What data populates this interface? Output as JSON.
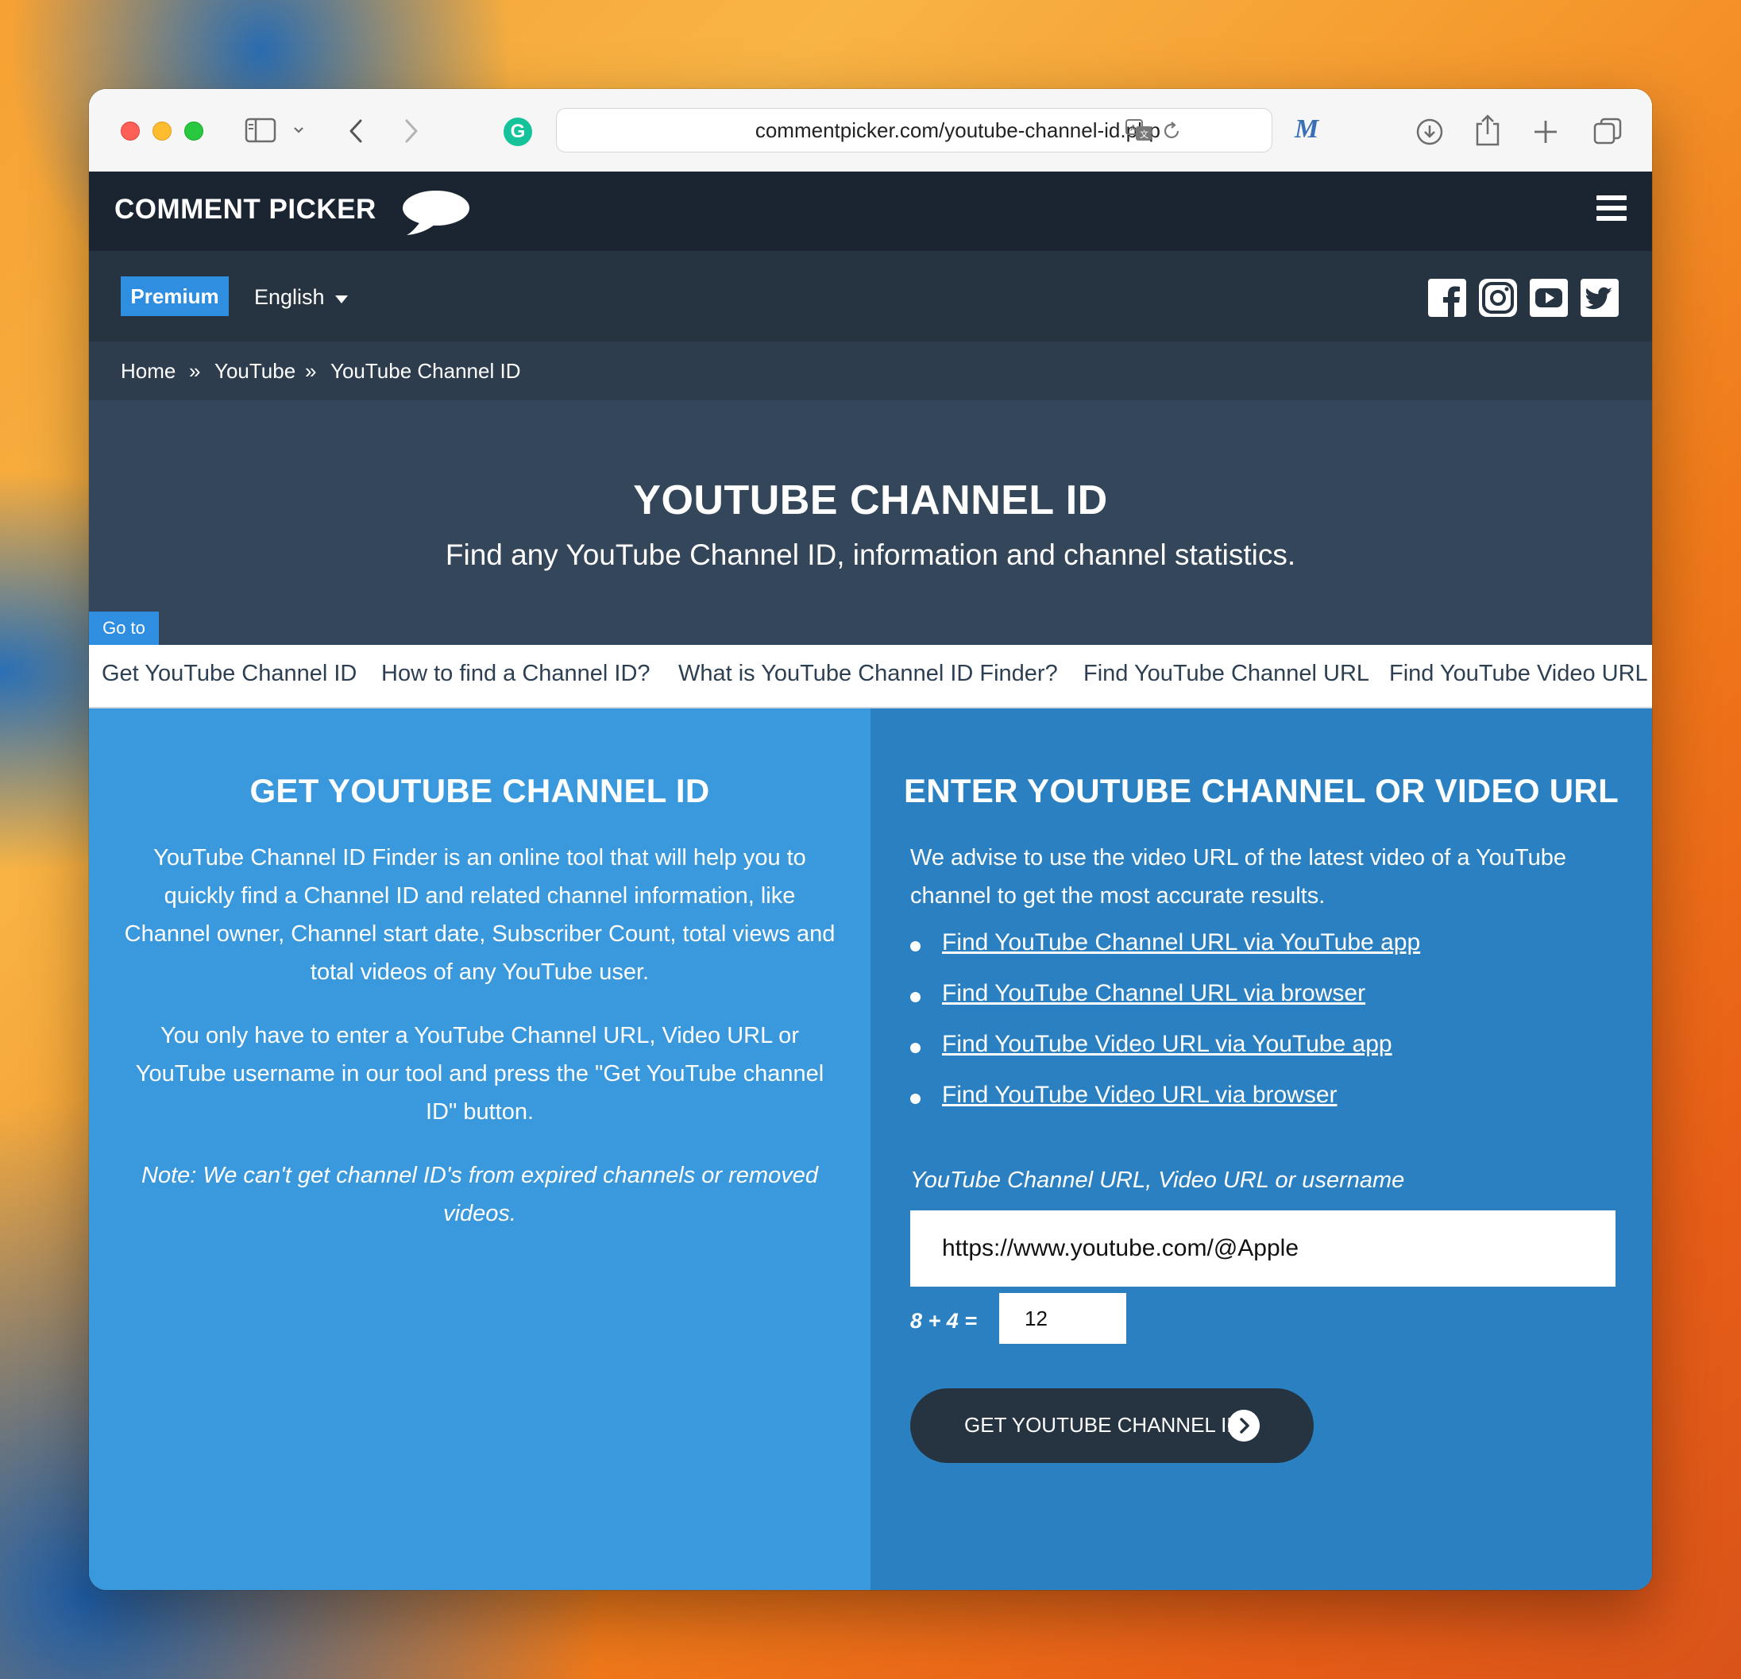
{
  "browser": {
    "url": "commentpicker.com/youtube-channel-id.php",
    "grammarly_glyph": "G",
    "extension_glyph": "M"
  },
  "site": {
    "logo": "COMMENT PICKER",
    "premium": "Premium",
    "language": "English",
    "social": [
      "facebook-icon",
      "instagram-icon",
      "youtube-icon",
      "twitter-icon"
    ]
  },
  "breadcrumb": {
    "home": "Home",
    "sep": "»",
    "section": "YouTube",
    "current": "YouTube Channel ID"
  },
  "hero": {
    "title": "YOUTUBE CHANNEL ID",
    "subtitle": "Find any YouTube Channel ID, information and channel statistics."
  },
  "goto": "Go to",
  "jump_links": [
    "Get YouTube Channel ID",
    "How to find a Channel ID?",
    "What is YouTube Channel ID Finder?",
    "Find YouTube Channel URL",
    "Find YouTube Video URL"
  ],
  "left": {
    "title": "GET YOUTUBE CHANNEL ID",
    "p1": "YouTube Channel ID Finder is an online tool that will help you to quickly find a Channel ID and related channel information, like Channel owner, Channel start date, Subscriber Count, total views and total videos of any YouTube user.",
    "p2": "You only have to enter a YouTube Channel URL, Video URL or YouTube username in our tool and press the \"Get YouTube channel ID\" button.",
    "note": "Note: We can't get channel ID's from expired channels or removed videos."
  },
  "right": {
    "title": "ENTER YOUTUBE CHANNEL OR VIDEO URL",
    "intro": "We advise to use the video URL of the latest video of a YouTube channel to get the most accurate results.",
    "links": [
      "Find YouTube Channel URL via YouTube app",
      "Find YouTube Channel URL via browser",
      "Find YouTube Video URL via YouTube app",
      "Find YouTube Video URL via browser"
    ],
    "input_label": "YouTube Channel URL, Video URL or username",
    "input_value": "https://www.youtube.com/@Apple",
    "captcha_label": "8 + 4 =",
    "captcha_value": "12",
    "button": "GET YOUTUBE CHANNEL ID"
  },
  "colors": {
    "nav_dark": "#1b2531",
    "accent_blue": "#2f8ee0",
    "left_panel": "#3a98dc",
    "right_panel": "#2a80c0"
  }
}
